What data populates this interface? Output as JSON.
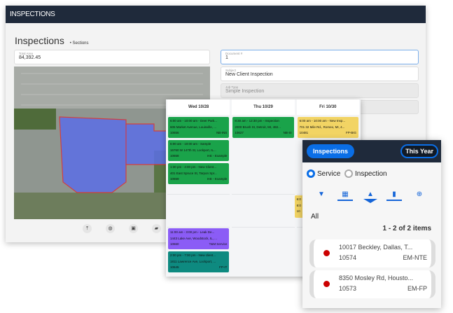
{
  "app": {
    "header": "INSPECTIONS",
    "title": "Inspections",
    "subtitle": "Sections"
  },
  "form": {
    "total_area": {
      "label": "Total Area",
      "value": "84,392.45"
    },
    "document": {
      "label": "Document #",
      "value": "1"
    },
    "subject": {
      "label": "Subject",
      "value": "New Client Inspection"
    },
    "job_type": {
      "label": "Job Type",
      "value": "Simple Inspection"
    }
  },
  "map_tools": [
    "upload-icon",
    "globe-icon",
    "camera-icon",
    "folder-icon"
  ],
  "calendar": {
    "days": [
      "Wed 10/28",
      "Thu 10/29",
      "Fri 10/30"
    ],
    "events": [
      {
        "day": 0,
        "t": "6:00 am - 10:00 am - Deer Park...",
        "a": "605 Market Avenue, Louisville, ...",
        "id": "10656",
        "c": "NB-INS",
        "color": "#1aa34a"
      },
      {
        "day": 0,
        "t": "6:00 am - 10:00 am - Sample",
        "a": "16760 W 147th St, Lockport, IL...",
        "id": "10658",
        "c": "IAE - Example",
        "color": "#1aa34a"
      },
      {
        "day": 0,
        "t": "1:30 pm - 4:00 pm - New Client...",
        "a": "401 East Spruce St, Tarpon Spr...",
        "id": "10659",
        "c": "IAE - Example",
        "color": "#1aa34a"
      },
      {
        "day": 0,
        "t": "11:00 am - 3:00 pm - Leak De...",
        "a": "1443 Lake Ave, Woodstock, IL, ...",
        "id": "10660",
        "c": "T&M Service",
        "color": "#8b5cf6"
      },
      {
        "day": 0,
        "t": "2:00 pm - 7:00 pm - New client...",
        "a": "1811 Lawrence Ave, Lockport, ...",
        "id": "10645",
        "c": "FP-IT",
        "color": "#0e8a80"
      },
      {
        "day": 1,
        "t": "8:30 am - 12:30 pm - Inspection",
        "a": "2000 Brush St, Detroit, MI, 482...",
        "id": "10627",
        "c": "NB-SI",
        "color": "#1aa34a"
      },
      {
        "day": 2,
        "t": "6:00 am - 10:00 am - New Insp...",
        "a": "701 32 Mile Rd., Romeo, MI, 4...",
        "id": "10481",
        "c": "FP-BIG",
        "color": "#f2d464"
      },
      {
        "day": 2,
        "t": "6:0",
        "a": "8:0",
        "id": "10",
        "c": "",
        "color": "#f2d464"
      }
    ]
  },
  "mobile": {
    "tab": "Inspections",
    "period": "This Year",
    "radios": [
      {
        "label": "Service",
        "checked": true
      },
      {
        "label": "Inspection",
        "checked": false
      }
    ],
    "filter": "All",
    "count": "1 - 2 of 2 items",
    "items": [
      {
        "address": "10017 Beckley, Dallas, T...",
        "id": "10574",
        "code": "EM-NTE"
      },
      {
        "address": "8350 Mosley Rd, Housto...",
        "id": "10573",
        "code": "EM-FP"
      }
    ],
    "colors": {
      "accent": "#0a6ee6",
      "status": "#cc0000"
    }
  }
}
